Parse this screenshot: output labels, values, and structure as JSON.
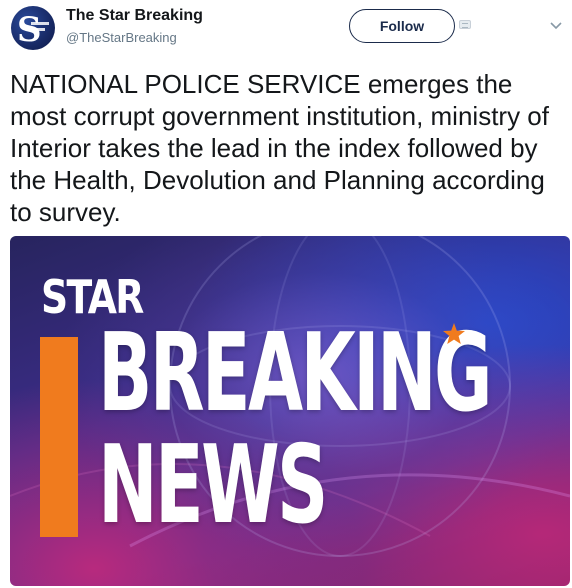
{
  "tweet": {
    "author": {
      "display_name": "The Star Breaking",
      "handle": "@TheStarBreaking"
    },
    "follow_label": "Follow",
    "text": "NATIONAL POLICE SERVICE emerges the most corrupt government institution, ministry of Interior takes the lead in the index followed by the Health, Devolution and Planning according to survey.",
    "media": {
      "logo_text": "STAR",
      "headline_line1": "BREAKING",
      "headline_line2": "NEWS"
    }
  },
  "colors": {
    "accent_orange": "#f07b1e",
    "follow_border": "#1b2b4b",
    "handle_gray": "#657786"
  },
  "icons": [
    "avatar-logo",
    "cc-icon",
    "chevron-down-icon",
    "star-icon"
  ]
}
